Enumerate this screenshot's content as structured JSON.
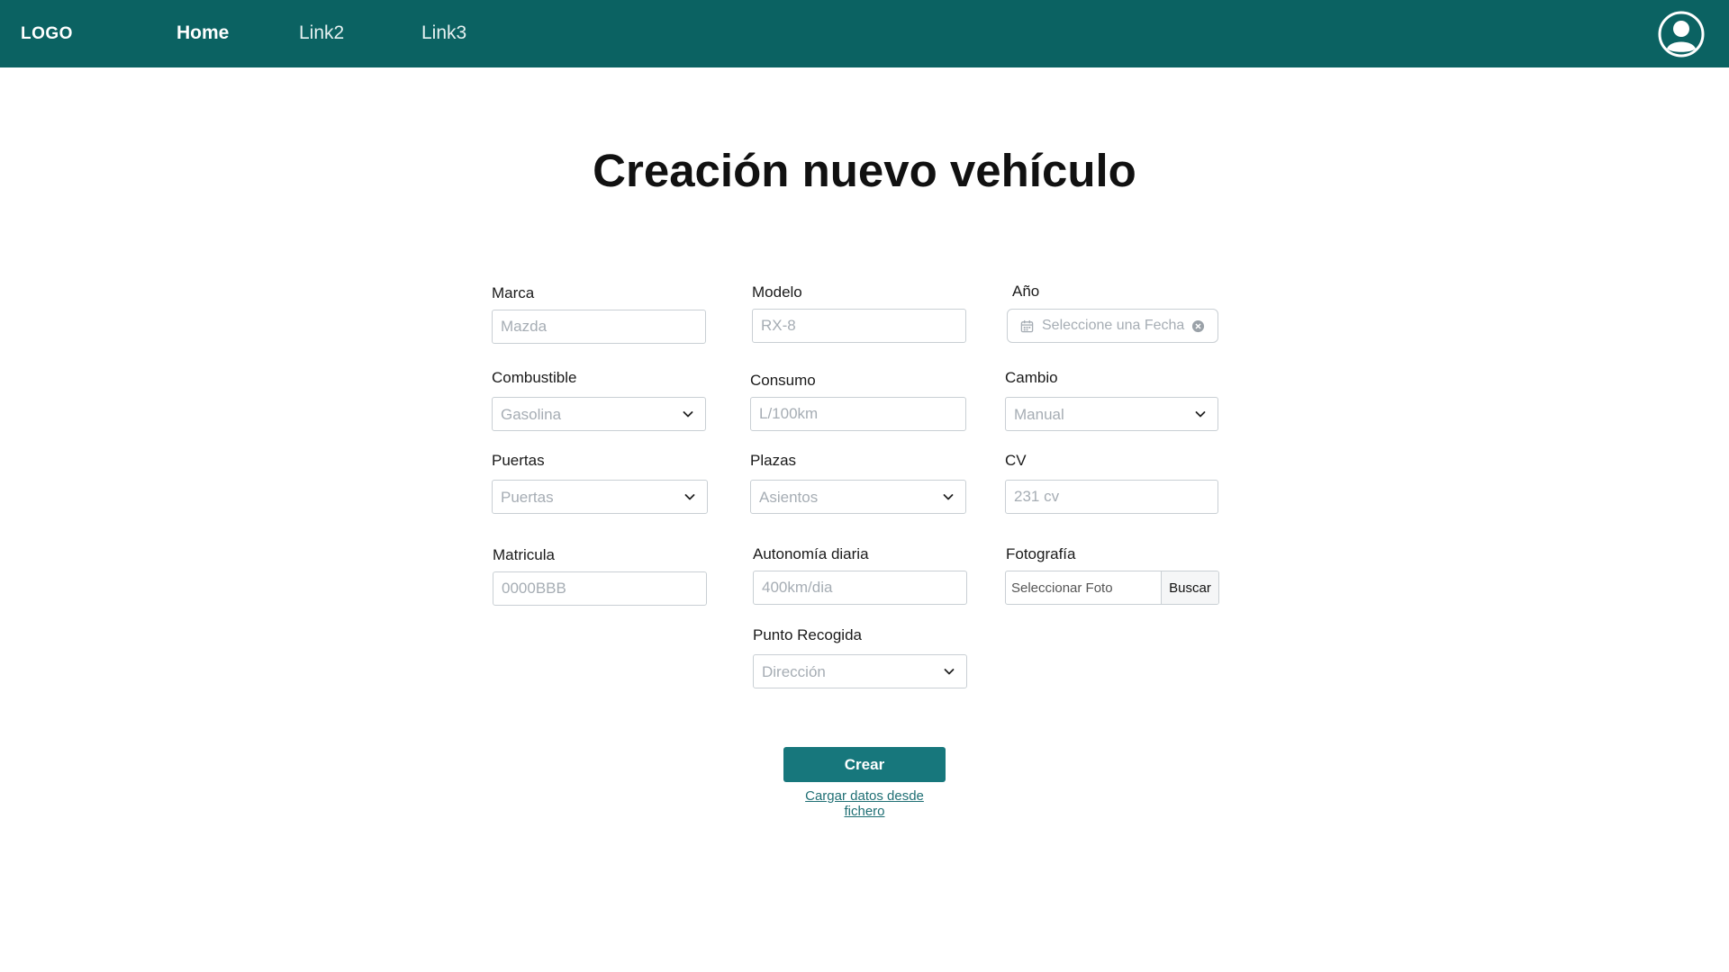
{
  "nav": {
    "logo": "LOGO",
    "links": [
      "Home",
      "Link2",
      "Link3"
    ],
    "active_link": "Home"
  },
  "page": {
    "title": "Creación nuevo vehículo"
  },
  "form": {
    "marca": {
      "label": "Marca",
      "placeholder": "Mazda"
    },
    "modelo": {
      "label": "Modelo",
      "placeholder": "RX-8"
    },
    "anio": {
      "label": "Año",
      "placeholder": "Seleccione una Fecha"
    },
    "combustible": {
      "label": "Combustible",
      "placeholder": "Gasolina"
    },
    "consumo": {
      "label": "Consumo",
      "placeholder": "L/100km"
    },
    "cambio": {
      "label": "Cambio",
      "placeholder": "Manual"
    },
    "puertas": {
      "label": "Puertas",
      "placeholder": "Puertas"
    },
    "plazas": {
      "label": "Plazas",
      "placeholder": "Asientos"
    },
    "cv": {
      "label": "CV",
      "placeholder": "231 cv"
    },
    "matricula": {
      "label": "Matricula",
      "placeholder": "0000BBB"
    },
    "autonomia": {
      "label": "Autonomía diaria",
      "placeholder": "400km/dia"
    },
    "fotografia": {
      "label": "Fotografía",
      "placeholder": "Seleccionar Foto",
      "button": "Buscar"
    },
    "punto_recogida": {
      "label": "Punto Recogida",
      "placeholder": "Dirección"
    }
  },
  "actions": {
    "create_label": "Crear",
    "load_file_label": "Cargar datos desde fichero"
  },
  "colors": {
    "navbar": "#0b6262",
    "primary": "#17777c",
    "link": "#1f6f74"
  }
}
